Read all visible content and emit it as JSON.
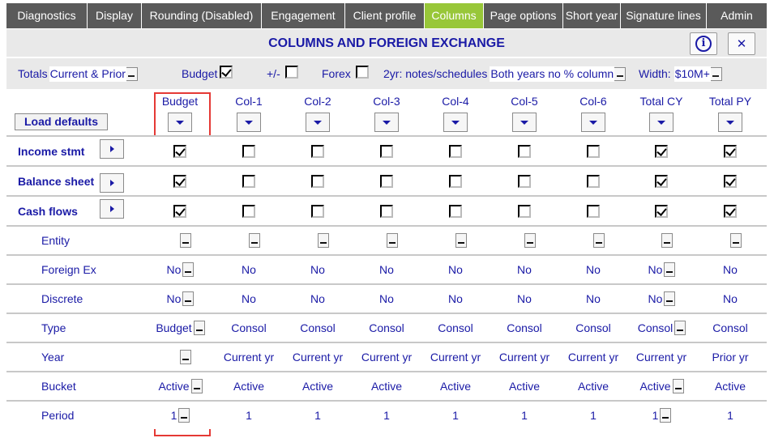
{
  "tabs": [
    {
      "label": "Diagnostics",
      "active": false
    },
    {
      "label": "Display",
      "active": false
    },
    {
      "label": "Rounding (Disabled)",
      "active": false
    },
    {
      "label": "Engagement",
      "active": false
    },
    {
      "label": "Client profile",
      "active": false
    },
    {
      "label": "Columns",
      "active": true
    },
    {
      "label": "Page options",
      "active": false
    },
    {
      "label": "Short year",
      "active": false
    },
    {
      "label": "Signature lines",
      "active": false
    },
    {
      "label": "Admin",
      "active": false
    }
  ],
  "title": "COLUMNS AND FOREIGN EXCHANGE",
  "title_buttons": {
    "info_icon": "info-icon",
    "close_icon": "close-icon",
    "close_glyph": "✕",
    "info_glyph": "i"
  },
  "options": {
    "totals_label": "Totals",
    "totals_value": "Current & Prior",
    "budget_label": "Budget",
    "budget_checked": true,
    "plusminus_label": "+/-",
    "plusminus_checked": false,
    "forex_label": "Forex",
    "forex_checked": false,
    "twoyr_label": "2yr: notes/schedules",
    "twoyr_value": "Both years no % column",
    "width_label": "Width:",
    "width_value": "$10M+"
  },
  "load_defaults_label": "Load defaults",
  "columns": [
    "Budget",
    "Col-1",
    "Col-2",
    "Col-3",
    "Col-4",
    "Col-5",
    "Col-6",
    "Total CY",
    "Total PY"
  ],
  "check_rows": [
    {
      "label": "Income stmt",
      "checks": [
        true,
        false,
        false,
        false,
        false,
        false,
        false,
        true,
        true
      ]
    },
    {
      "label": "Balance sheet",
      "checks": [
        true,
        false,
        false,
        false,
        false,
        false,
        false,
        true,
        true
      ]
    },
    {
      "label": "Cash flows",
      "checks": [
        true,
        false,
        false,
        false,
        false,
        false,
        false,
        true,
        true
      ]
    }
  ],
  "field_rows": [
    {
      "label": "Entity",
      "values": [
        "",
        "",
        "",
        "",
        "",
        "",
        "",
        "",
        ""
      ],
      "dropdown": [
        true,
        true,
        true,
        true,
        true,
        true,
        true,
        true,
        true
      ]
    },
    {
      "label": "Foreign Ex",
      "values": [
        "No",
        "No",
        "No",
        "No",
        "No",
        "No",
        "No",
        "No",
        "No"
      ],
      "dropdown": [
        true,
        false,
        false,
        false,
        false,
        false,
        false,
        true,
        false
      ]
    },
    {
      "label": "Discrete",
      "values": [
        "No",
        "No",
        "No",
        "No",
        "No",
        "No",
        "No",
        "No",
        "No"
      ],
      "dropdown": [
        true,
        false,
        false,
        false,
        false,
        false,
        false,
        true,
        false
      ]
    },
    {
      "label": "Type",
      "values": [
        "Budget",
        "Consol",
        "Consol",
        "Consol",
        "Consol",
        "Consol",
        "Consol",
        "Consol",
        "Consol"
      ],
      "dropdown": [
        true,
        false,
        false,
        false,
        false,
        false,
        false,
        true,
        false
      ]
    },
    {
      "label": "Year",
      "values": [
        "",
        "Current yr",
        "Current yr",
        "Current yr",
        "Current yr",
        "Current yr",
        "Current yr",
        "Current yr",
        "Prior yr"
      ],
      "dropdown": [
        true,
        false,
        false,
        false,
        false,
        false,
        false,
        false,
        false
      ]
    },
    {
      "label": "Bucket",
      "values": [
        "Active",
        "Active",
        "Active",
        "Active",
        "Active",
        "Active",
        "Active",
        "Active",
        "Active"
      ],
      "dropdown": [
        true,
        false,
        false,
        false,
        false,
        false,
        false,
        true,
        false
      ]
    },
    {
      "label": "Period",
      "values": [
        "1",
        "1",
        "1",
        "1",
        "1",
        "1",
        "1",
        "1",
        "1"
      ],
      "dropdown": [
        true,
        false,
        false,
        false,
        false,
        false,
        false,
        true,
        false
      ]
    }
  ],
  "colors": {
    "tab_bg": "#5a5a5a",
    "tab_active": "#98c739",
    "label_blue": "#1a1aa6",
    "band_gray": "#e9e9e9",
    "highlight_red": "#e53935"
  }
}
